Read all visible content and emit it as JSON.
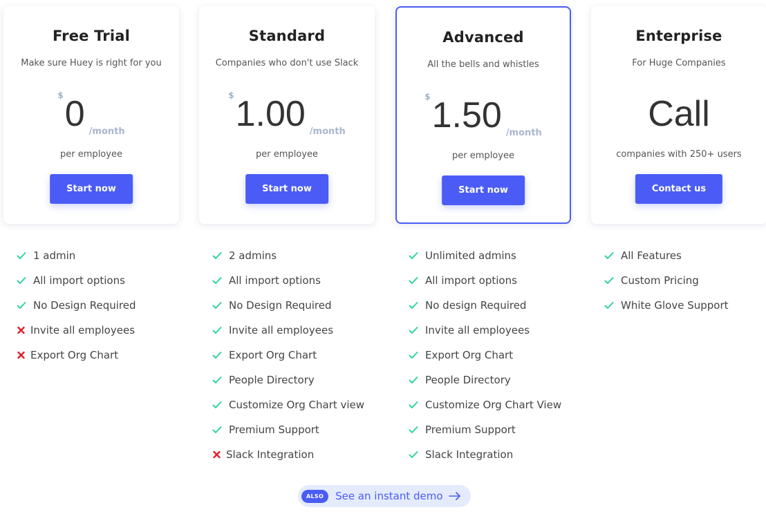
{
  "colors": {
    "accent": "#4a5cf5",
    "check": "#2dd4a0",
    "cross": "#e01e2c",
    "muted_price": "#a8b6cf"
  },
  "plans": [
    {
      "title": "Free Trial",
      "subtitle": "Make sure Huey is right for you",
      "currency": "$",
      "amount": "0",
      "period": "/month",
      "unit": "per employee",
      "cta": "Start now",
      "featured": false,
      "features": [
        {
          "text": "1 admin",
          "included": true
        },
        {
          "text": "All import options",
          "included": true
        },
        {
          "text": "No Design Required",
          "included": true
        },
        {
          "text": "Invite all employees",
          "included": false
        },
        {
          "text": "Export Org Chart",
          "included": false
        }
      ]
    },
    {
      "title": "Standard",
      "subtitle": "Companies who don't use Slack",
      "currency": "$",
      "amount": "1.00",
      "period": "/month",
      "unit": "per employee",
      "cta": "Start now",
      "featured": false,
      "features": [
        {
          "text": "2 admins",
          "included": true
        },
        {
          "text": "All import options",
          "included": true
        },
        {
          "text": "No Design Required",
          "included": true
        },
        {
          "text": "Invite all employees",
          "included": true
        },
        {
          "text": "Export Org Chart",
          "included": true
        },
        {
          "text": "People Directory",
          "included": true
        },
        {
          "text": "Customize Org Chart view",
          "included": true
        },
        {
          "text": "Premium Support",
          "included": true
        },
        {
          "text": "Slack Integration",
          "included": false
        }
      ]
    },
    {
      "title": "Advanced",
      "subtitle": "All the bells and whistles",
      "currency": "$",
      "amount": "1.50",
      "period": "/month",
      "unit": "per employee",
      "cta": "Start now",
      "featured": true,
      "features": [
        {
          "text": "Unlimited admins",
          "included": true
        },
        {
          "text": "All import options",
          "included": true
        },
        {
          "text": "No design Required",
          "included": true
        },
        {
          "text": "Invite all employees",
          "included": true
        },
        {
          "text": "Export Org Chart",
          "included": true
        },
        {
          "text": "People Directory",
          "included": true
        },
        {
          "text": "Customize Org Chart View",
          "included": true
        },
        {
          "text": "Premium Support",
          "included": true
        },
        {
          "text": "Slack Integration",
          "included": true
        }
      ]
    },
    {
      "title": "Enterprise",
      "subtitle": "For Huge Companies",
      "price_text": "Call",
      "unit": "companies with 250+ users",
      "cta": "Contact us",
      "featured": false,
      "features": [
        {
          "text": "All Features",
          "included": true
        },
        {
          "text": "Custom Pricing",
          "included": true
        },
        {
          "text": "White Glove Support",
          "included": true
        }
      ]
    }
  ],
  "demo": {
    "badge": "ALSO",
    "label": "See an instant demo",
    "icon": "arrow-right-icon"
  }
}
